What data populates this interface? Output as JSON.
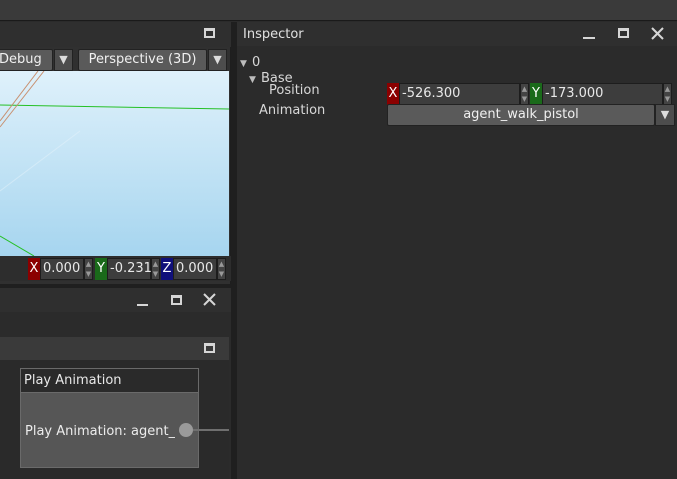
{
  "viewport": {
    "mode_dropdown": "Debug",
    "projection_dropdown": "Perspective (3D)",
    "coords": [
      {
        "axis": "X",
        "value": "0.000",
        "color": "#8b0000"
      },
      {
        "axis": "Y",
        "value": "-0.231",
        "color": "#1a6a1a"
      },
      {
        "axis": "Z",
        "value": "0.000",
        "color": "#10107a"
      }
    ]
  },
  "graph": {
    "node_title": "Play Animation",
    "node_body": "Play Animation: agent_w"
  },
  "inspector": {
    "title": "Inspector",
    "root_label": "0",
    "base_label": "Base",
    "position_label": "Position",
    "position_x": "-526.300",
    "position_y": "-173.000",
    "animation_label": "Animation",
    "animation_value": "agent_walk_pistol"
  },
  "colors": {
    "axis_x": "#8b0000",
    "axis_y": "#1a6a1a",
    "axis_z": "#10107a",
    "sky_top": "#d8eef9",
    "sky_bottom": "#a8d6f0"
  },
  "icons": {
    "maximize": "maximize-icon",
    "minimize": "minimize-icon",
    "close": "close-icon",
    "dropdown": "triangle-down-icon"
  }
}
